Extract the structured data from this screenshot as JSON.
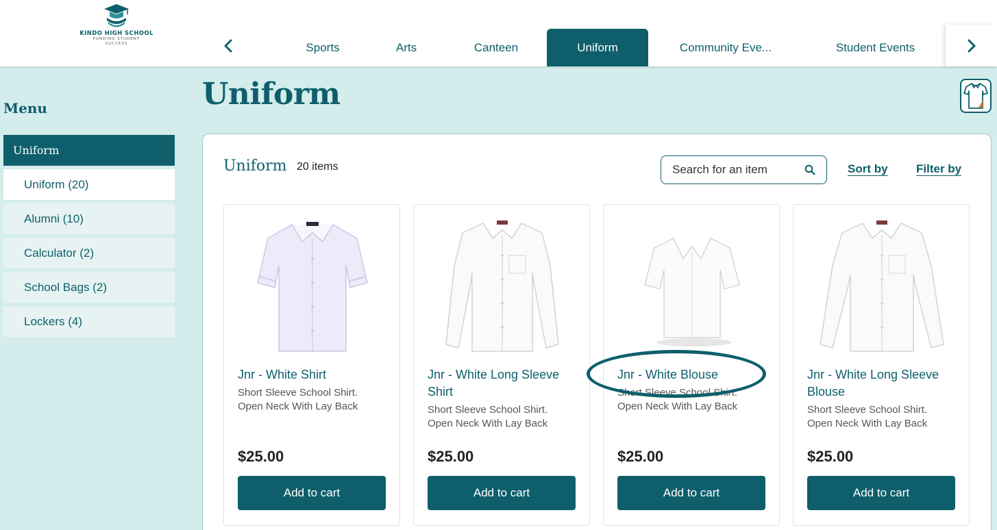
{
  "logo": {
    "name": "KINDO HIGH SCHOOL",
    "tagline_1": "FUNDING STUDENT",
    "tagline_2": "SUCCESS"
  },
  "nav": {
    "tabs": [
      {
        "label": "Sports"
      },
      {
        "label": "Arts"
      },
      {
        "label": "Canteen"
      },
      {
        "label": "Uniform",
        "active": true
      },
      {
        "label": "Community Eve..."
      },
      {
        "label": "Student Events"
      }
    ]
  },
  "sidebar": {
    "title": "Menu",
    "header": "Uniform",
    "items": [
      {
        "label": "Uniform (20)",
        "selected": true
      },
      {
        "label": "Alumni (10)"
      },
      {
        "label": "Calculator (2)"
      },
      {
        "label": "School Bags (2)"
      },
      {
        "label": "Lockers (4)"
      }
    ]
  },
  "page": {
    "title": "Uniform"
  },
  "panel": {
    "title": "Uniform",
    "count": "20 items",
    "search_placeholder": "Search for an item",
    "sort_label": "Sort by",
    "filter_label": "Filter by"
  },
  "products": [
    {
      "name": "Jnr - White Shirt",
      "desc": "Short Sleeve School Shirt. Open Neck With Lay Back Collar for Junior Students",
      "price": "$25.00",
      "button": "Add to cart"
    },
    {
      "name": "Jnr - White Long Sleeve Shirt",
      "desc": "Short Sleeve School Shirt. Open Neck With Lay Back Collar for Junior Students",
      "price": "$25.00",
      "button": "Add to cart"
    },
    {
      "name": "Jnr - White Blouse",
      "desc": "Short Sleeve School Shirt. Open Neck With Lay Back Collar for Junior Students",
      "price": "$25.00",
      "button": "Add to cart"
    },
    {
      "name": "Jnr - White Long Sleeve Blouse",
      "desc": "Short Sleeve School Shirt. Open Neck With Lay Back Collar for Junior Students",
      "price": "$25.00",
      "button": "Add to cart"
    }
  ],
  "colors": {
    "brand": "#0e5f6b",
    "background": "#d4ecec",
    "accent": "#e8752a"
  }
}
